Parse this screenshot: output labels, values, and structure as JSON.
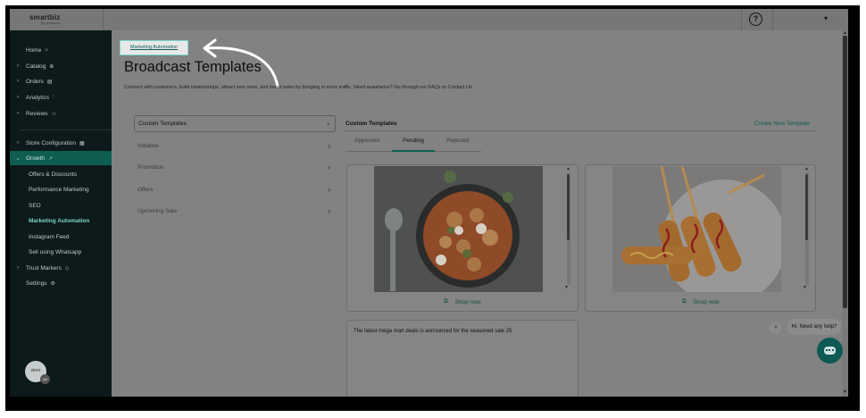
{
  "brand": {
    "name": "smartbiz",
    "tagline": "by amazon"
  },
  "header": {
    "help_icon": "help-circle-icon",
    "account_chevron": "▾"
  },
  "sidebar": {
    "items": [
      {
        "label": "Home",
        "icon": "⌂"
      },
      {
        "label": "Catalog",
        "icon": "⊕"
      },
      {
        "label": "Orders",
        "icon": "▤"
      },
      {
        "label": "Analytics",
        "icon": "⫶"
      },
      {
        "label": "Reviews",
        "icon": "☆"
      },
      {
        "label": "Store Configuration",
        "icon": "▦"
      },
      {
        "label": "Growth",
        "icon": "↗"
      },
      {
        "label": "Offers & Discounts"
      },
      {
        "label": "Performance Marketing"
      },
      {
        "label": "SEO"
      },
      {
        "label": "Marketing Automation"
      },
      {
        "label": "Instagram Feed"
      },
      {
        "label": "Sell using Whatsapp"
      },
      {
        "label": "Trust Markers",
        "icon": "◇"
      },
      {
        "label": "Settings",
        "icon": "⚙"
      }
    ],
    "avatar": {
      "initials": "store",
      "badge": "68"
    }
  },
  "main": {
    "breadcrumb": "Marketing Automation",
    "title": "Broadcast Templates",
    "subtitle": "Connect with customers, build relationships, attract new ones, and boost sales by bringing in more traffic. Need assistance? Go through our FAQs or Contact Us",
    "categories": [
      "Custom Templates",
      "Initiative",
      "Promotion",
      "Offers",
      "Upcoming Sale"
    ],
    "panel_title": "Custom Templates",
    "create_link": "Create New Template",
    "tabs": [
      "Approved",
      "Pending",
      "Rejected"
    ],
    "active_tab": "Pending",
    "cards": [
      {
        "image": "gnocchi-dish-photo",
        "action": "Shop now"
      },
      {
        "image": "corn-dog-skewers-photo",
        "action": "Shop now"
      }
    ],
    "message_text": "The latest mega mart deals is announced for the seasoned sale 25"
  },
  "chat": {
    "prompt": "Hi. Need any help?",
    "close": "×"
  },
  "colors": {
    "accent": "#0f5e52",
    "sidebar_bg": "#0c1a1b",
    "highlight": "#79d9ce"
  }
}
